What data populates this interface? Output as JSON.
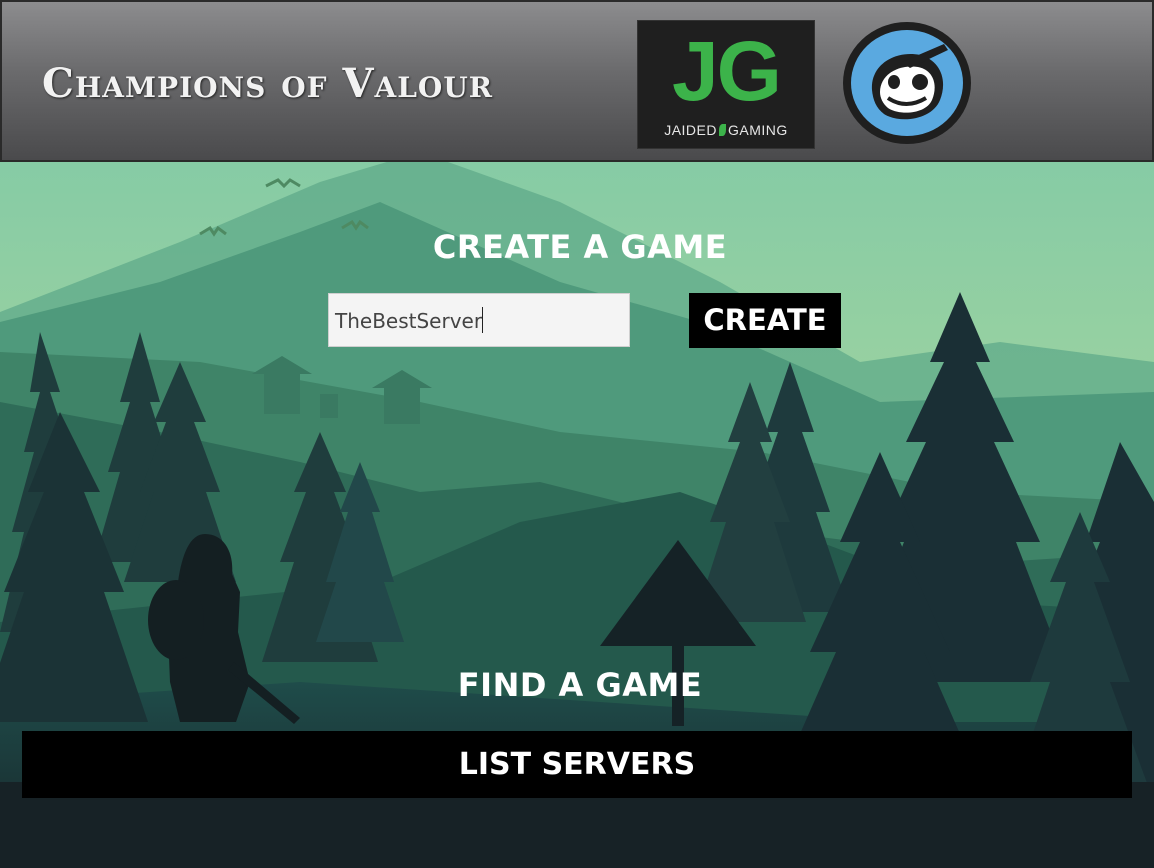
{
  "header": {
    "title": "Champions of Valour",
    "jg_logo": {
      "letters": "JG",
      "left_word": "JAIDED",
      "right_word": "GAMING",
      "color": "#3cb34a"
    },
    "mascot_icon": "round-mascot-logo-icon"
  },
  "create": {
    "heading": "CREATE A GAME",
    "server_name_value": "TheBestServer",
    "button_label": "CREATE"
  },
  "find": {
    "heading": "FIND A GAME",
    "button_label": "LIST SERVERS"
  },
  "colors": {
    "sky_top": "#86cba5",
    "sky_bottom": "#c2dd9a",
    "forest_dark": "#1b2b30"
  }
}
